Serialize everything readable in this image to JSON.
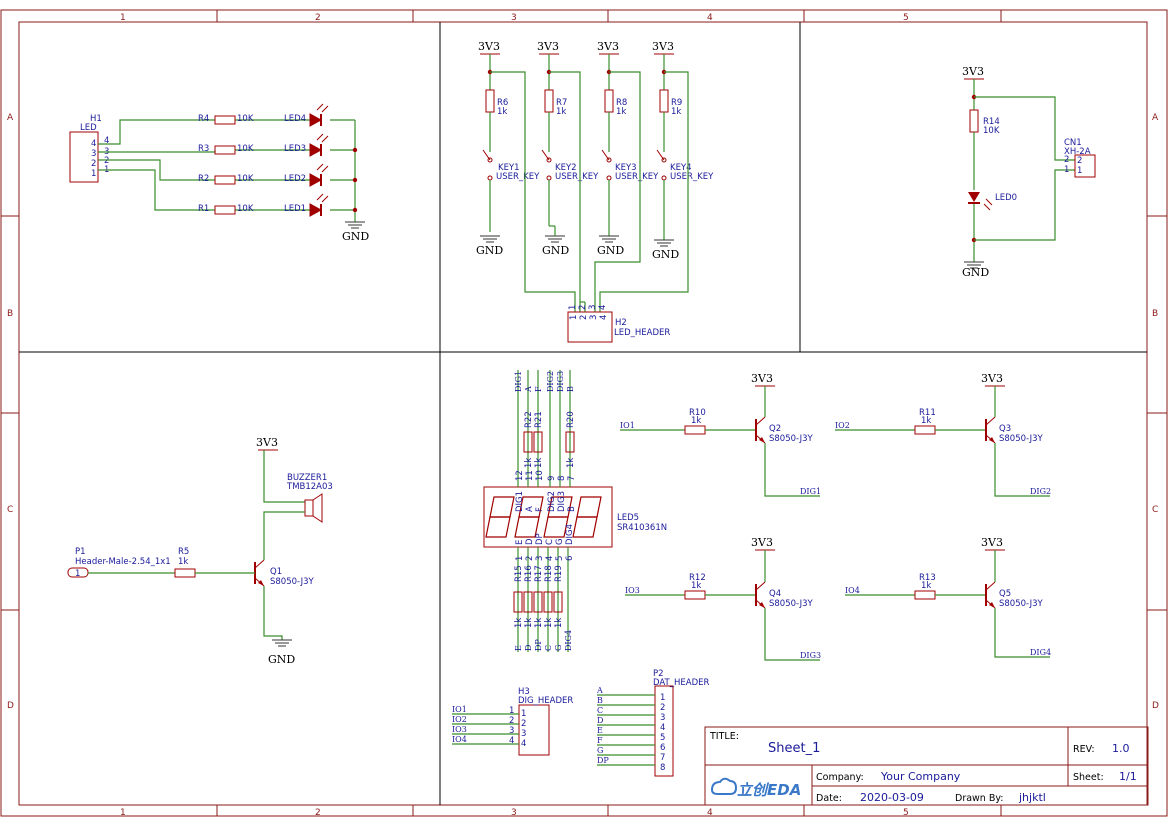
{
  "border": {
    "cols": [
      "1",
      "2",
      "3",
      "4",
      "5"
    ],
    "rows": [
      "A",
      "B",
      "C",
      "D"
    ]
  },
  "power": {
    "v33": "3V3",
    "gnd": "GND"
  },
  "h1": {
    "ref": "H1",
    "val": "LED",
    "pins": [
      "4",
      "3",
      "2",
      "1"
    ]
  },
  "leds": [
    {
      "r": "R4",
      "rv": "10K",
      "led": "LED4"
    },
    {
      "r": "R3",
      "rv": "10K",
      "led": "LED3"
    },
    {
      "r": "R2",
      "rv": "10K",
      "led": "LED2"
    },
    {
      "r": "R1",
      "rv": "10K",
      "led": "LED1"
    }
  ],
  "keys": [
    {
      "r": "R6",
      "rv": "1k",
      "k": "KEY1",
      "kv": "USER_KEY"
    },
    {
      "r": "R7",
      "rv": "1k",
      "k": "KEY2",
      "kv": "USER_KEY"
    },
    {
      "r": "R8",
      "rv": "1k",
      "k": "KEY3",
      "kv": "USER_KEY"
    },
    {
      "r": "R9",
      "rv": "1k",
      "k": "KEY4",
      "kv": "USER_KEY"
    }
  ],
  "h2": {
    "ref": "H2",
    "val": "LED_HEADER",
    "pins": [
      "1",
      "2",
      "3",
      "4"
    ]
  },
  "cn1": {
    "ref": "CN1",
    "val": "XH-2A",
    "pins": [
      "2",
      "1"
    ],
    "r": "R14",
    "rv": "10K",
    "led": "LED0"
  },
  "buzzer": {
    "ref": "BUZZER1",
    "val": "TMB12A03",
    "p": "P1",
    "pv": "Header-Male-2.54_1x1",
    "ppin": "1",
    "r": "R5",
    "rv": "1k",
    "q": "Q1",
    "qv": "S8050-J3Y"
  },
  "seg": {
    "ref": "LED5",
    "val": "SR410361N",
    "top_nets": [
      "DIG1",
      "A",
      "F",
      "DIG2",
      "DIG3",
      "B"
    ],
    "top_res": [
      "R22",
      "R21",
      "R20"
    ],
    "top_pins": [
      "12",
      "11",
      "10",
      "9",
      "8",
      "7"
    ],
    "top_rv": [
      "1k",
      "1k",
      "1k"
    ],
    "top_inner": [
      "DIG1",
      "A",
      "F",
      "DIG2",
      "DIG3",
      "B"
    ],
    "bot_inner": [
      "E",
      "D",
      "DP",
      "C",
      "G",
      "DIG4"
    ],
    "bot_pins": [
      "1",
      "2",
      "3",
      "4",
      "5",
      "6"
    ],
    "bot_res": [
      "R15",
      "R16",
      "R17",
      "R18",
      "R19"
    ],
    "bot_rv": [
      "1k",
      "1k",
      "1k",
      "1k",
      "1k"
    ],
    "bot_nets": [
      "E",
      "D",
      "DP",
      "C",
      "G",
      "DIG4"
    ]
  },
  "drivers": [
    {
      "io": "IO1",
      "r": "R10",
      "rv": "1k",
      "q": "Q2",
      "qv": "S8050-J3Y",
      "dig": "DIG1"
    },
    {
      "io": "IO2",
      "r": "R11",
      "rv": "1k",
      "q": "Q3",
      "qv": "S8050-J3Y",
      "dig": "DIG2"
    },
    {
      "io": "IO3",
      "r": "R12",
      "rv": "1k",
      "q": "Q4",
      "qv": "S8050-J3Y",
      "dig": "DIG3"
    },
    {
      "io": "IO4",
      "r": "R13",
      "rv": "1k",
      "q": "Q5",
      "qv": "S8050-J3Y",
      "dig": "DIG4"
    }
  ],
  "h3": {
    "ref": "H3",
    "val": "DIG_HEADER",
    "nets": [
      "IO1",
      "IO2",
      "IO3",
      "IO4"
    ],
    "pins": [
      "1",
      "2",
      "3",
      "4"
    ]
  },
  "p2": {
    "ref": "P2",
    "val": "DAT_HEADER",
    "nets": [
      "A",
      "B",
      "C",
      "D",
      "E",
      "F",
      "G",
      "DP"
    ],
    "pins": [
      "1",
      "2",
      "3",
      "4",
      "5",
      "6",
      "7",
      "8"
    ]
  },
  "title": {
    "title_label": "TITLE:",
    "title": "Sheet_1",
    "rev_label": "REV:",
    "rev": "1.0",
    "company_label": "Company:",
    "company": "Your Company",
    "sheet_label": "Sheet:",
    "sheet": "1/1",
    "date_label": "Date:",
    "date": "2020-03-09",
    "drawn_label": "Drawn By:",
    "drawn": "jhjktl",
    "logo": "立创EDA"
  },
  "colors": {
    "border": "#8b1a1a",
    "wire": "#3a8e2a",
    "component": "#a00000",
    "text": "#1a1a9a"
  }
}
